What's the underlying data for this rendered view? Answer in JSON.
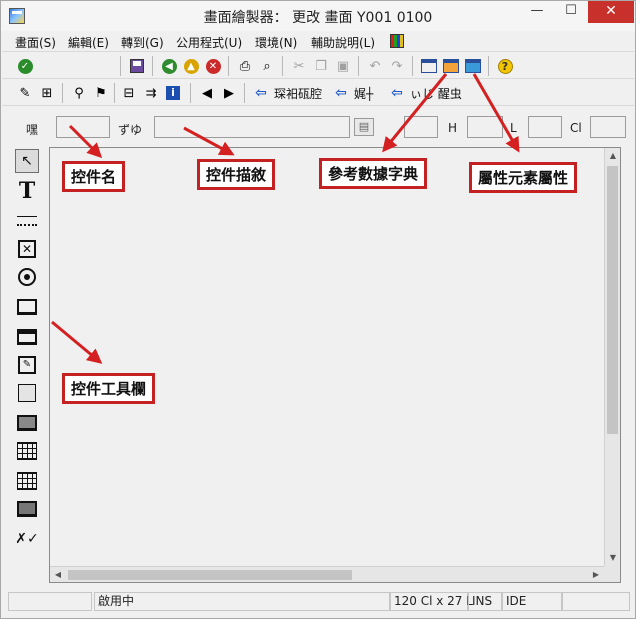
{
  "window": {
    "title": "畫面繪製器： 更改 畫面 Y001 0100",
    "minimize_glyph": "—",
    "maximize_glyph": "☐",
    "close_glyph": "✕"
  },
  "menubar": {
    "items": [
      "畫面(S)",
      "編輯(E)",
      "轉到(G)",
      "公用程式(U)",
      "環境(N)",
      "輔助說明(L)"
    ],
    "palette_icon": "color-palette-icon"
  },
  "toolbar1": {
    "icons": [
      "check-icon",
      "save-icon",
      "back-icon",
      "exit-icon",
      "cancel-icon",
      "print-icon",
      "find-icon",
      "cut-icon",
      "copy-icon",
      "paste-icon",
      "undo-icon",
      "redo-icon",
      "dictionary-icon",
      "attributes-icon",
      "element-list-icon",
      "help-icon"
    ]
  },
  "toolbar2": {
    "prev_glyph": "◀",
    "next_glyph": "▶",
    "label1": "琛衵砙腔",
    "label2": "娓┼",
    "label3": "ぃじ  醒虫"
  },
  "fieldrow": {
    "name_label": "嘿",
    "name_value": "",
    "desc_label": "ずゆ",
    "desc_value": "",
    "h_label": "H",
    "l_label": "L",
    "cl_label": "Cl"
  },
  "palette": {
    "text_glyph": "T",
    "check_glyph": "✕",
    "pointer_glyph": "↖"
  },
  "statusbar": {
    "mode": "啟用中",
    "size": "120 Cl x 27 L",
    "ins": "INS",
    "ide": "IDE"
  },
  "callouts": {
    "control_name": "控件名",
    "control_desc": "控件描敘",
    "dictionary": "參考數據字典",
    "attributes": "屬性元素屬性",
    "toolbox": "控件工具欄"
  },
  "colors": {
    "callout_border": "#c42222",
    "arrow": "#d42020",
    "close_button": "#c7302b"
  }
}
